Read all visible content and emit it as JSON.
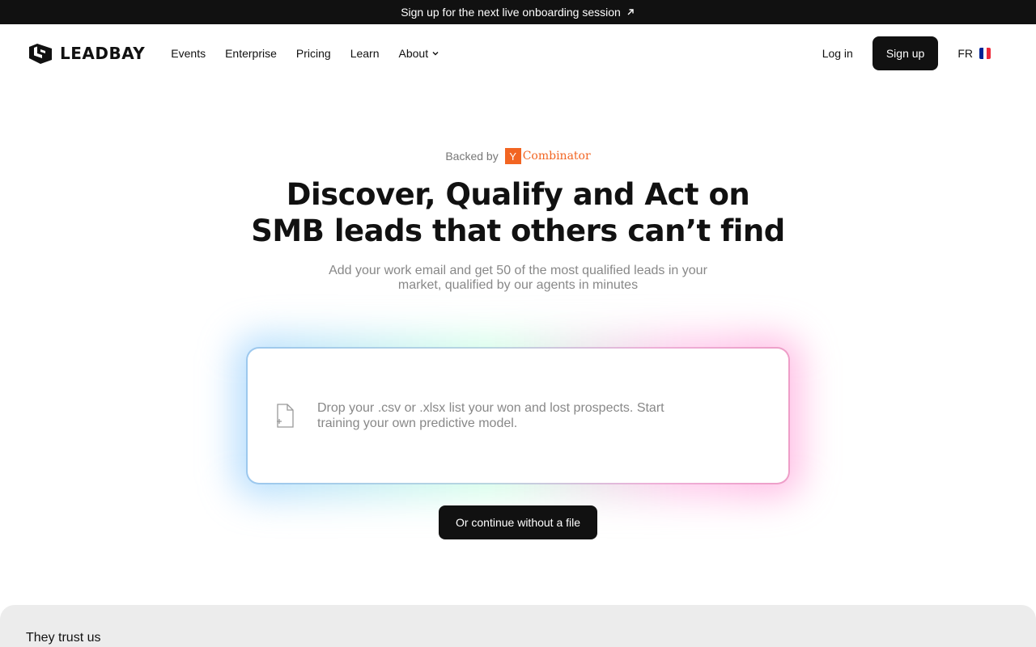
{
  "announcement": {
    "text": "Sign up for the next live onboarding session",
    "arrow_icon": "arrow-up-right-icon"
  },
  "nav": {
    "logo_text": "LEADBAY",
    "items": [
      "Events",
      "Enterprise",
      "Pricing",
      "Learn",
      "About"
    ],
    "login": "Log in",
    "signup": "Sign up",
    "lang": "FR",
    "flag_colors": [
      "#002395",
      "#ffffff",
      "#ed2939"
    ]
  },
  "hero": {
    "backed_by": "Backed by",
    "yc_letter": "Y",
    "yc_word": "Combinator",
    "headline_line1": "Discover, Qualify and Act on",
    "headline_line2": "SMB leads that others can’t find",
    "subtitle": "Add your work email and get 50 of the most qualified leads in your market, qualified by our agents in minutes"
  },
  "dropzone": {
    "text": "Drop your .csv or .xlsx list your won and lost prospects. Start training your own predictive model."
  },
  "cta": {
    "label": "Or continue without a file"
  },
  "trust": {
    "title": "They trust us"
  },
  "colors": {
    "brand_dark": "#111111",
    "yc_orange": "#f26522",
    "muted_text": "#888888"
  }
}
